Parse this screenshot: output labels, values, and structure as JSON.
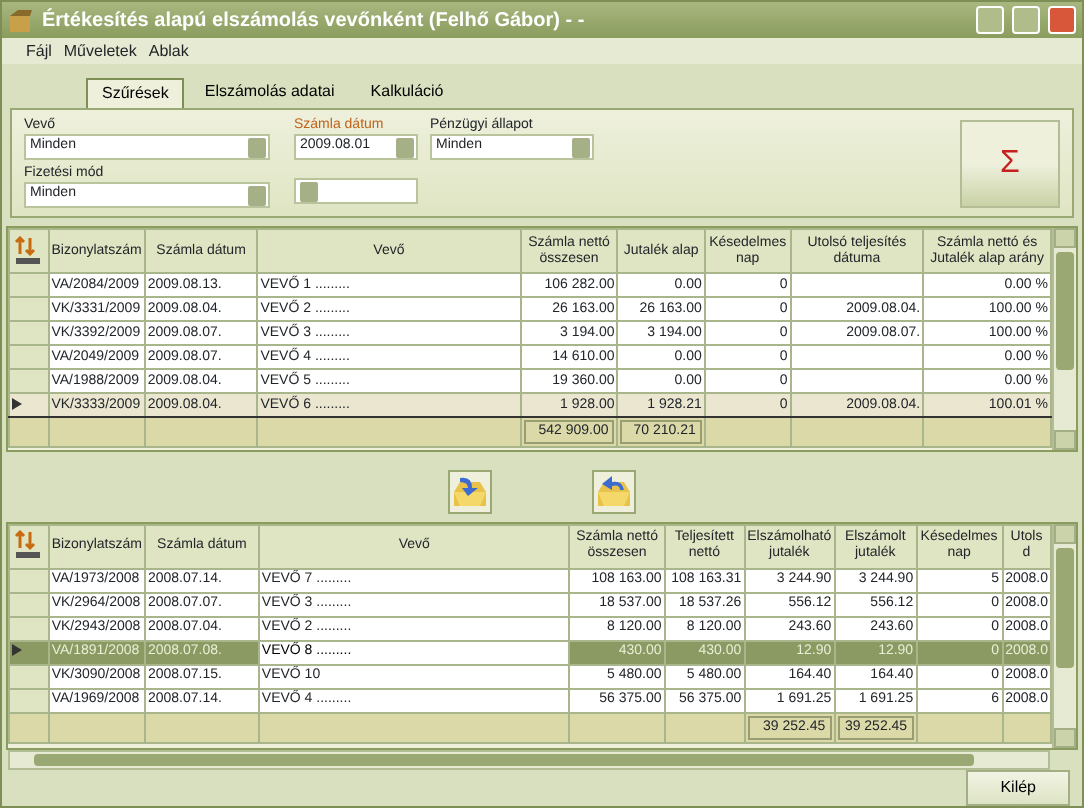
{
  "window": {
    "title": "Értékesítés alapú elszámolás vevőnként (Felhő Gábor)  -  -"
  },
  "menu": [
    "Fájl",
    "Műveletek",
    "Ablak"
  ],
  "tabs": [
    {
      "label": "Szűrések",
      "selected": true
    },
    {
      "label": "Elszámolás adatai",
      "selected": false
    },
    {
      "label": "Kalkuláció",
      "selected": false
    }
  ],
  "filters": {
    "customer": {
      "label": "Vevő",
      "value": "Minden"
    },
    "payment_method": {
      "label": "Fizetési mód",
      "value": "Minden"
    },
    "invoice_date": {
      "label": "Számla dátum",
      "from": "2009.08.01"
    },
    "financial_status": {
      "label": "Pénzügyi állapot",
      "value": "Minden"
    },
    "sum_button": "Σ"
  },
  "top_table": {
    "columns": [
      "Bizonylatszám",
      "Számla dátum",
      "Vevő",
      "Számla nettó összesen",
      "Jutalék alap",
      "Késedelmes nap",
      "Utolsó teljesítés dátuma",
      "Számla nettó és Jutalék alap arány"
    ],
    "rows": [
      {
        "selected": false,
        "cells": [
          "VA/2084/2009",
          "2009.08.13.",
          "VEVŐ 1 .........",
          "106 282.00",
          "0.00",
          "0",
          "",
          "0.00 %"
        ]
      },
      {
        "selected": false,
        "cells": [
          "VK/3331/2009",
          "2009.08.04.",
          "VEVŐ 2 .........",
          "26 163.00",
          "26 163.00",
          "0",
          "2009.08.04.",
          "100.00 %"
        ]
      },
      {
        "selected": false,
        "cells": [
          "VK/3392/2009",
          "2009.08.07.",
          "VEVŐ 3 .........",
          "3 194.00",
          "3 194.00",
          "0",
          "2009.08.07.",
          "100.00 %"
        ]
      },
      {
        "selected": false,
        "cells": [
          "VA/2049/2009",
          "2009.08.07.",
          "VEVŐ 4 .........",
          "14 610.00",
          "0.00",
          "0",
          "",
          "0.00 %"
        ]
      },
      {
        "selected": false,
        "cells": [
          "VA/1988/2009",
          "2009.08.04.",
          "VEVŐ 5 .........",
          "19 360.00",
          "0.00",
          "0",
          "",
          "0.00 %"
        ]
      },
      {
        "selected": true,
        "cells": [
          "VK/3333/2009",
          "2009.08.04.",
          "VEVŐ 6 .........",
          "1 928.00",
          "1 928.21",
          "0",
          "2009.08.04.",
          "100.01 %"
        ]
      }
    ],
    "totals": [
      "542 909.00",
      "70 210.21"
    ]
  },
  "bottom_table": {
    "columns": [
      "Bizonylatszám",
      "Számla dátum",
      "Vevő",
      "Számla nettó összesen",
      "Teljesített nettó",
      "Elszámolható jutalék",
      "Elszámolt jutalék",
      "Késedelmes nap",
      "Utols d"
    ],
    "rows": [
      {
        "selected": false,
        "cells": [
          "VA/1973/2008",
          "2008.07.14.",
          "VEVŐ 7 .........",
          "108 163.00",
          "108 163.31",
          "3 244.90",
          "3 244.90",
          "5",
          "2008.0"
        ]
      },
      {
        "selected": false,
        "cells": [
          "VK/2964/2008",
          "2008.07.07.",
          "VEVŐ 3 .........",
          "18 537.00",
          "18 537.26",
          "556.12",
          "556.12",
          "0",
          "2008.0"
        ]
      },
      {
        "selected": false,
        "cells": [
          "VK/2943/2008",
          "2008.07.04.",
          "VEVŐ 2 .........",
          "8 120.00",
          "8 120.00",
          "243.60",
          "243.60",
          "0",
          "2008.0"
        ]
      },
      {
        "selected": true,
        "cells": [
          "VA/1891/2008",
          "2008.07.08.",
          "VEVŐ 8 .........",
          "430.00",
          "430.00",
          "12.90",
          "12.90",
          "0",
          "2008.0"
        ]
      },
      {
        "selected": false,
        "cells": [
          "VK/3090/2008",
          "2008.07.15.",
          "VEVŐ 10",
          "5 480.00",
          "5 480.00",
          "164.40",
          "164.40",
          "0",
          "2008.0"
        ]
      },
      {
        "selected": false,
        "cells": [
          "VA/1969/2008",
          "2008.07.14.",
          "VEVŐ 4 .........",
          "56 375.00",
          "56 375.00",
          "1 691.25",
          "1 691.25",
          "6",
          "2008.0"
        ]
      }
    ],
    "totals": [
      "39 252.45",
      "39 252.45"
    ]
  },
  "exit_button": "Kilép"
}
